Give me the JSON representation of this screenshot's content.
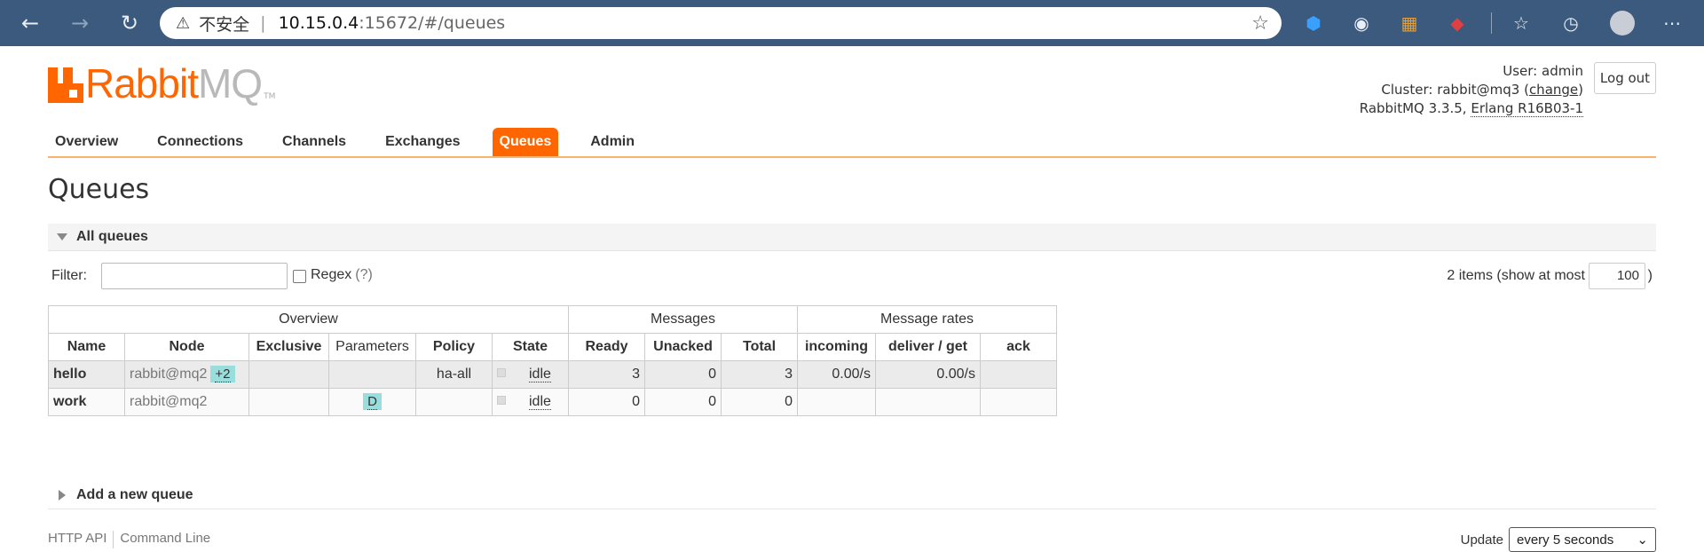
{
  "browser": {
    "back_icon": "back-arrow-icon",
    "forward_icon": "forward-arrow-icon",
    "refresh_icon": "refresh-icon",
    "insecure_label": "不安全",
    "separator": "|",
    "url_host": "10.15.0.4",
    "url_path": ":15672/#/queues"
  },
  "logo": {
    "part1": "Rabbit",
    "part2": "MQ",
    "tm": "TM"
  },
  "user_info": {
    "user_line": "User: admin",
    "cluster_prefix": "Cluster: rabbit@mq3 (",
    "change_link": "change",
    "cluster_suffix": ")",
    "version_prefix": "RabbitMQ 3.3.5, ",
    "erlang": "Erlang R16B03-1"
  },
  "logout_label": "Log out",
  "tabs": [
    "Overview",
    "Connections",
    "Channels",
    "Exchanges",
    "Queues",
    "Admin"
  ],
  "active_tab": "Queues",
  "page_title": "Queues",
  "all_queues_label": "All queues",
  "filter": {
    "label": "Filter:",
    "value": "",
    "regex_label": "Regex",
    "regex_help": "(?)",
    "items_text": "2 items (show at most",
    "max_value": "100",
    "close_paren": ")"
  },
  "table": {
    "groups": {
      "overview": "Overview",
      "messages": "Messages",
      "rates": "Message rates"
    },
    "headers": [
      "Name",
      "Node",
      "Exclusive",
      "Parameters",
      "Policy",
      "State",
      "Ready",
      "Unacked",
      "Total",
      "incoming",
      "deliver / get",
      "ack"
    ],
    "rows": [
      {
        "name": "hello",
        "node": "rabbit@mq2",
        "node_badge": "+2",
        "exclusive": "",
        "parameters": "",
        "policy": "ha-all",
        "state": "idle",
        "ready": "3",
        "unacked": "0",
        "total": "3",
        "incoming": "0.00/s",
        "deliver_get": "0.00/s",
        "ack": ""
      },
      {
        "name": "work",
        "node": "rabbit@mq2",
        "node_badge": "",
        "exclusive": "",
        "parameters": "D",
        "policy": "",
        "state": "idle",
        "ready": "0",
        "unacked": "0",
        "total": "0",
        "incoming": "",
        "deliver_get": "",
        "ack": ""
      }
    ]
  },
  "add_queue_label": "Add a new queue",
  "footer": {
    "http_api": "HTTP API",
    "command_line": "Command Line",
    "update_label": "Update",
    "update_value": "every 5 seconds"
  },
  "colors": {
    "brand": "#ff6600",
    "browser_bar": "#3c5a7e",
    "badge": "#99dddd"
  }
}
